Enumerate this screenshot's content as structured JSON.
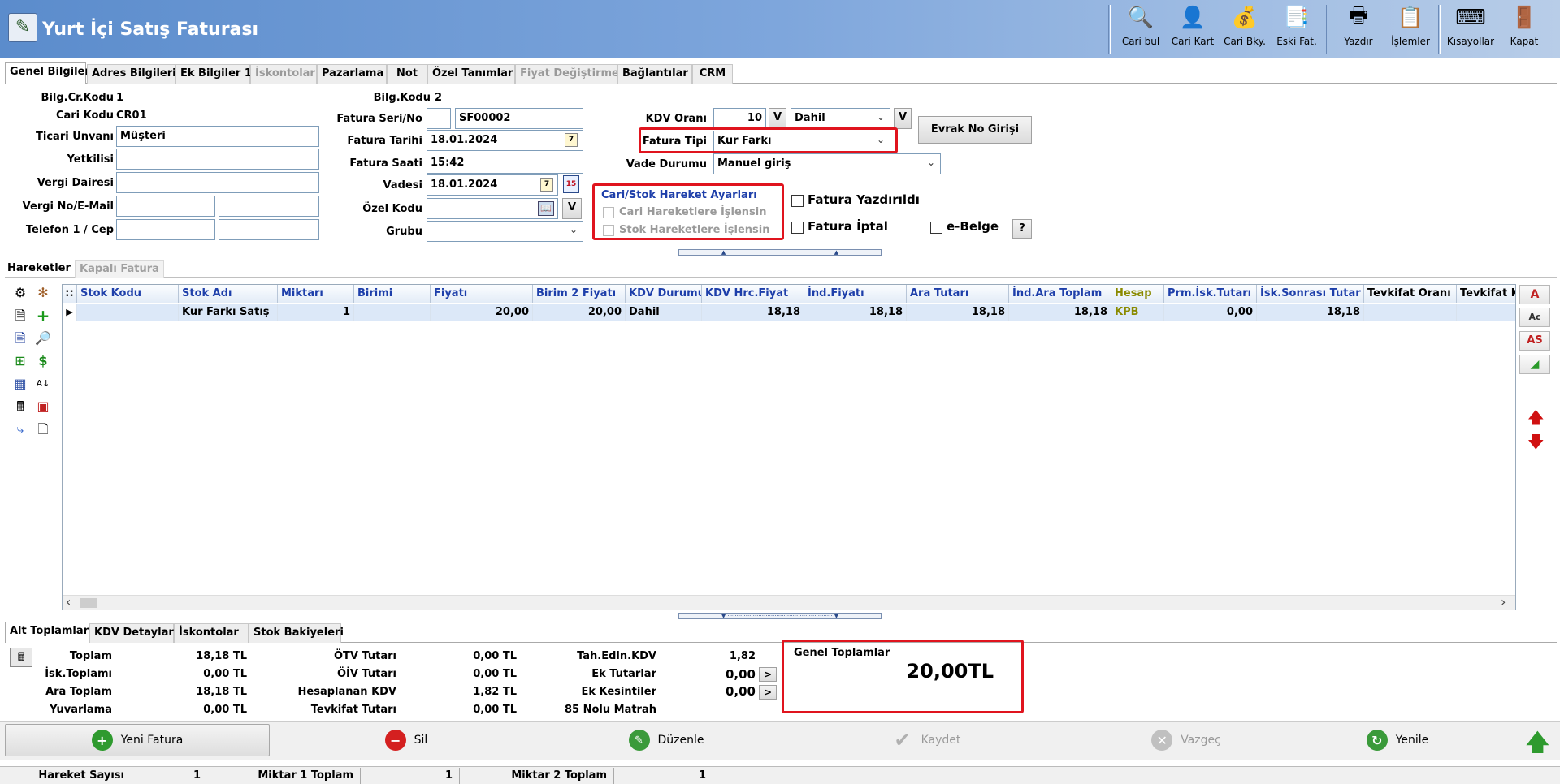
{
  "window": {
    "title": "Yurt İçi Satış Faturası"
  },
  "toolbar": [
    {
      "label": "Cari bul",
      "icon": "user-search-icon"
    },
    {
      "label": "Cari Kart",
      "icon": "user-card-icon"
    },
    {
      "label": "Cari Bky.",
      "icon": "user-balance-icon"
    },
    {
      "label": "Eski Fat.",
      "icon": "old-invoice-icon"
    },
    {
      "label": "Yazdır",
      "icon": "printer-icon"
    },
    {
      "label": "İşlemler",
      "icon": "operations-icon"
    },
    {
      "label": "Kısayollar",
      "icon": "keyboard-icon"
    },
    {
      "label": "Kapat",
      "icon": "exit-door-icon"
    }
  ],
  "top_tabs": [
    {
      "label": "Genel Bilgiler",
      "active": true,
      "disabled": false
    },
    {
      "label": "Adres Bilgileri",
      "active": false,
      "disabled": false
    },
    {
      "label": "Ek Bilgiler 1",
      "active": false,
      "disabled": false
    },
    {
      "label": "İskontolar",
      "active": false,
      "disabled": true
    },
    {
      "label": "Pazarlama",
      "active": false,
      "disabled": false
    },
    {
      "label": "Not",
      "active": false,
      "disabled": false
    },
    {
      "label": "Özel Tanımlar",
      "active": false,
      "disabled": false
    },
    {
      "label": "Fiyat Değiştirme",
      "active": false,
      "disabled": true
    },
    {
      "label": "Bağlantılar",
      "active": false,
      "disabled": false
    },
    {
      "label": "CRM",
      "active": false,
      "disabled": false
    }
  ],
  "form": {
    "bilg_cr_kodu_label": "Bilg.Cr.Kodu",
    "bilg_cr_kodu": "1",
    "cari_kodu_label": "Cari Kodu",
    "cari_kodu": "CR01",
    "ticari_unvani_label": "Ticari Unvanı",
    "ticari_unvani": "Müşteri",
    "yetkilisi_label": "Yetkilisi",
    "yetkilisi": "",
    "vergi_dairesi_label": "Vergi Dairesi",
    "vergi_dairesi": "",
    "vergi_no_label": "Vergi No/E-Mail",
    "vergi_no": "",
    "email": "",
    "telefon_label": "Telefon 1 / Cep",
    "telefon": "",
    "cep": "",
    "bilg_kodu2_label": "Bilg.Kodu",
    "bilg_kodu2": "2",
    "fatura_seri_label": "Fatura Seri/No",
    "fatura_seri": "",
    "fatura_no": "SF00002",
    "fatura_tarihi_label": "Fatura Tarihi",
    "fatura_tarihi": "18.01.2024",
    "fatura_saati_label": "Fatura Saati",
    "fatura_saati": "15:42",
    "vadesi_label": "Vadesi",
    "vadesi": "18.01.2024",
    "ozel_kodu_label": "Özel Kodu",
    "ozel_kodu": "",
    "grubu_label": "Grubu",
    "grubu": "",
    "kdv_orani_label": "KDV Oranı",
    "kdv_orani": "10",
    "kdv_dahil": "Dahil",
    "v_btn": "V",
    "fatura_tipi_label": "Fatura Tipi",
    "fatura_tipi": "Kur Farkı",
    "vade_durumu_label": "Vade Durumu",
    "vade_durumu": "Manuel giriş",
    "evrak_no_btn": "Evrak No Girişi",
    "cal_day": "7",
    "cal_day2": "15",
    "hareket_group_title": "Cari/Stok Hareket Ayarları",
    "cari_hareket": "Cari Hareketlere İşlensin",
    "stok_hareket": "Stok Hareketlere İşlensin",
    "fatura_yazdirildi": "Fatura Yazdırıldı",
    "fatura_iptal": "Fatura İptal",
    "e_belge": "e-Belge",
    "help_btn": "?"
  },
  "grid_tabs": [
    {
      "label": "Hareketler",
      "active": true,
      "disabled": false
    },
    {
      "label": "Kapalı Fatura",
      "active": false,
      "disabled": true
    }
  ],
  "grid": {
    "columns": [
      "Stok Kodu",
      "Stok Adı",
      "Miktarı",
      "Birimi",
      "Fiyatı",
      "Birim 2 Fiyatı",
      "KDV Durumu",
      "KDV Hrc.Fiyat",
      "İnd.Fiyatı",
      "Ara Tutarı",
      "İnd.Ara Toplam",
      "Hesap",
      "Prm.İsk.Tutarı",
      "İsk.Sonrası Tutar",
      "Tevkifat Oranı",
      "Tevkifat Ko"
    ],
    "rows": [
      [
        "",
        "Kur Farkı Satış",
        "1",
        "",
        "20,00",
        "20,00",
        "Dahil",
        "18,18",
        "18,18",
        "18,18",
        "18,18",
        "KPB",
        "0,00",
        "18,18",
        "",
        ""
      ]
    ],
    "hesap_color": "#8a8a00",
    "scroll_left": "‹",
    "scroll_right": "›"
  },
  "right_buttons": [
    "A",
    "Ac",
    "AS",
    "",
    "",
    ""
  ],
  "bottom_tabs": [
    {
      "label": "Alt Toplamlar",
      "active": true
    },
    {
      "label": "KDV Detayları",
      "active": false
    },
    {
      "label": "İskontolar",
      "active": false
    },
    {
      "label": "Stok Bakiyeleri",
      "active": false
    }
  ],
  "totals": {
    "toplam_label": "Toplam",
    "toplam": "18,18 TL",
    "isk_toplami_label": "İsk.Toplamı",
    "isk_toplami": "0,00 TL",
    "ara_toplam_label": "Ara Toplam",
    "ara_toplam": "18,18 TL",
    "yuvarlama_label": "Yuvarlama",
    "yuvarlama": "0,00 TL",
    "otv_label": "ÖTV Tutarı",
    "otv": "0,00 TL",
    "oiv_label": "ÖİV Tutarı",
    "oiv": "0,00 TL",
    "hesaplanan_kdv_label": "Hesaplanan KDV",
    "hesaplanan_kdv": "1,82 TL",
    "tevkifat_label": "Tevkifat Tutarı",
    "tevkifat": "0,00 TL",
    "tah_kdv_label": "Tah.Edln.KDV",
    "tah_kdv": "1,82",
    "ek_tutarlar_label": "Ek Tutarlar",
    "ek_tutarlar": "0,00",
    "ek_kesintiler_label": "Ek Kesintiler",
    "ek_kesintiler": "0,00",
    "matrah_label": "85 Nolu Matrah",
    "arrow_btn": ">",
    "genel_toplamlar_title": "Genel Toplamlar",
    "genel_toplam": "20,00TL"
  },
  "actions": [
    {
      "label": "Yeni Fatura",
      "icon": "plus-circle-icon",
      "color": "#2e9a2e",
      "disabled": false
    },
    {
      "label": "Sil",
      "icon": "delete-circle-icon",
      "color": "#d42020",
      "disabled": false
    },
    {
      "label": "Düzenle",
      "icon": "edit-icon",
      "color": "#3a9a3a",
      "disabled": false
    },
    {
      "label": "Kaydet",
      "icon": "check-icon",
      "color": "#b0b0b0",
      "disabled": true
    },
    {
      "label": "Vazgeç",
      "icon": "cancel-icon",
      "color": "#b0b0b0",
      "disabled": true
    },
    {
      "label": "Yenile",
      "icon": "refresh-icon",
      "color": "#3a9a3a",
      "disabled": false
    }
  ],
  "status": {
    "hareket_sayisi_label": "Hareket Sayısı",
    "hareket_sayisi": "1",
    "miktar1_label": "Miktar 1 Toplam",
    "miktar1": "1",
    "miktar2_label": "Miktar 2 Toplam",
    "miktar2": "1"
  },
  "colors": {
    "title_bar": "#5d8fcf",
    "highlight_box": "#e0141e",
    "selected_row": "#dce8f8"
  }
}
